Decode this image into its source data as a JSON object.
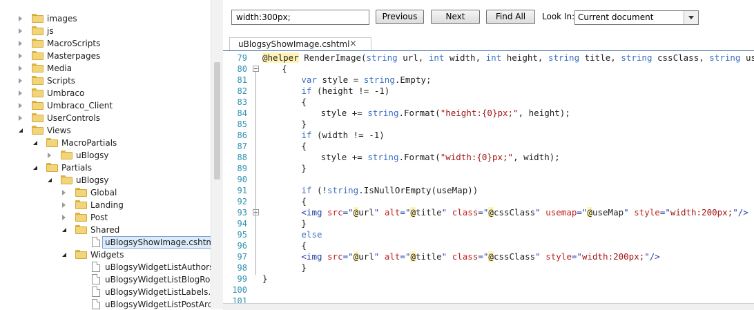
{
  "tree": {
    "items": [
      {
        "label": "images",
        "level": 0,
        "expander": "collapsed",
        "icon": "folder"
      },
      {
        "label": "js",
        "level": 0,
        "expander": "collapsed",
        "icon": "folder"
      },
      {
        "label": "MacroScripts",
        "level": 0,
        "expander": "collapsed",
        "icon": "folder"
      },
      {
        "label": "Masterpages",
        "level": 0,
        "expander": "collapsed",
        "icon": "folder"
      },
      {
        "label": "Media",
        "level": 0,
        "expander": "collapsed",
        "icon": "folder"
      },
      {
        "label": "Scripts",
        "level": 0,
        "expander": "collapsed",
        "icon": "folder"
      },
      {
        "label": "Umbraco",
        "level": 0,
        "expander": "collapsed",
        "icon": "folder"
      },
      {
        "label": "Umbraco_Client",
        "level": 0,
        "expander": "collapsed",
        "icon": "folder"
      },
      {
        "label": "UserControls",
        "level": 0,
        "expander": "collapsed",
        "icon": "folder"
      },
      {
        "label": "Views",
        "level": 0,
        "expander": "expanded",
        "icon": "folder"
      },
      {
        "label": "MacroPartials",
        "level": 1,
        "expander": "expanded",
        "icon": "folder"
      },
      {
        "label": "uBlogsy",
        "level": 2,
        "expander": "collapsed",
        "icon": "folder"
      },
      {
        "label": "Partials",
        "level": 1,
        "expander": "expanded",
        "icon": "folder"
      },
      {
        "label": "uBlogsy",
        "level": 2,
        "expander": "expanded",
        "icon": "folder"
      },
      {
        "label": "Global",
        "level": 3,
        "expander": "collapsed",
        "icon": "folder"
      },
      {
        "label": "Landing",
        "level": 3,
        "expander": "collapsed",
        "icon": "folder"
      },
      {
        "label": "Post",
        "level": 3,
        "expander": "collapsed",
        "icon": "folder"
      },
      {
        "label": "Shared",
        "level": 3,
        "expander": "expanded",
        "icon": "folder"
      },
      {
        "label": "uBlogsyShowImage.cshtml",
        "level": 4,
        "expander": "none",
        "icon": "file",
        "selected": true
      },
      {
        "label": "Widgets",
        "level": 3,
        "expander": "expanded",
        "icon": "folder"
      },
      {
        "label": "uBlogsyWidgetListAuthors.c",
        "level": 4,
        "expander": "none",
        "icon": "file"
      },
      {
        "label": "uBlogsyWidgetListBlogRoll.c",
        "level": 4,
        "expander": "none",
        "icon": "file"
      },
      {
        "label": "uBlogsyWidgetListLabels.csh",
        "level": 4,
        "expander": "none",
        "icon": "file"
      },
      {
        "label": "uBlogsyWidgetListPostArchi",
        "level": 4,
        "expander": "none",
        "icon": "file"
      }
    ]
  },
  "findbar": {
    "query": "width:300px;",
    "previous_label": "Previous",
    "next_label": "Next",
    "find_all_label": "Find All",
    "look_in_label": "Look In:",
    "look_in_value": "Current document"
  },
  "editor": {
    "tab_label": "uBlogsyShowImage.cshtml",
    "tab_close": "×",
    "lines": [
      {
        "n": "79",
        "indent": 0,
        "tokens": [
          [
            "razor",
            "@helper"
          ],
          [
            "plain",
            " RenderImage("
          ],
          [
            "kw",
            "string"
          ],
          [
            "plain",
            " url, "
          ],
          [
            "kw",
            "int"
          ],
          [
            "plain",
            " width, "
          ],
          [
            "kw",
            "int"
          ],
          [
            "plain",
            " height, "
          ],
          [
            "kw",
            "string"
          ],
          [
            "plain",
            " title, "
          ],
          [
            "kw",
            "string"
          ],
          [
            "plain",
            " cssClass, "
          ],
          [
            "kw",
            "string"
          ],
          [
            "plain",
            " useMap)"
          ]
        ]
      },
      {
        "n": "80",
        "indent": 4,
        "fold": true,
        "tokens": [
          [
            "plain",
            "{"
          ]
        ]
      },
      {
        "n": "81",
        "indent": 8,
        "tokens": [
          [
            "kw",
            "var"
          ],
          [
            "plain",
            " style = "
          ],
          [
            "kw",
            "string"
          ],
          [
            "plain",
            ".Empty;"
          ]
        ]
      },
      {
        "n": "82",
        "indent": 8,
        "tokens": [
          [
            "kw",
            "if"
          ],
          [
            "plain",
            " (height != -1)"
          ]
        ]
      },
      {
        "n": "83",
        "indent": 8,
        "tokens": [
          [
            "plain",
            "{"
          ]
        ]
      },
      {
        "n": "84",
        "indent": 12,
        "tokens": [
          [
            "plain",
            "style += "
          ],
          [
            "kw",
            "string"
          ],
          [
            "plain",
            ".Format("
          ],
          [
            "str",
            "\"height:{0}px;\""
          ],
          [
            "plain",
            ", height);"
          ]
        ]
      },
      {
        "n": "85",
        "indent": 8,
        "tokens": [
          [
            "plain",
            "}"
          ]
        ]
      },
      {
        "n": "86",
        "indent": 8,
        "tokens": [
          [
            "kw",
            "if"
          ],
          [
            "plain",
            " (width != -1)"
          ]
        ]
      },
      {
        "n": "87",
        "indent": 8,
        "tokens": [
          [
            "plain",
            "{"
          ]
        ]
      },
      {
        "n": "88",
        "indent": 12,
        "tokens": [
          [
            "plain",
            "style += "
          ],
          [
            "kw",
            "string"
          ],
          [
            "plain",
            ".Format("
          ],
          [
            "str",
            "\"width:{0}px;\""
          ],
          [
            "plain",
            ", width);"
          ]
        ]
      },
      {
        "n": "89",
        "indent": 8,
        "tokens": [
          [
            "plain",
            "}"
          ]
        ]
      },
      {
        "n": "90",
        "indent": 0,
        "tokens": []
      },
      {
        "n": "91",
        "indent": 8,
        "tokens": [
          [
            "kw",
            "if"
          ],
          [
            "plain",
            " (!"
          ],
          [
            "kw",
            "string"
          ],
          [
            "plain",
            ".IsNullOrEmpty(useMap))"
          ]
        ]
      },
      {
        "n": "92",
        "indent": 8,
        "tokens": [
          [
            "plain",
            "{"
          ]
        ]
      },
      {
        "n": "93",
        "indent": 8,
        "fold": true,
        "tokens": [
          [
            "tag",
            "<img"
          ],
          [
            "plain",
            " "
          ],
          [
            "attr",
            "src"
          ],
          [
            "tag",
            "=\""
          ],
          [
            "razor",
            "@"
          ],
          [
            "plain",
            "url"
          ],
          [
            "tag",
            "\""
          ],
          [
            "plain",
            " "
          ],
          [
            "attr",
            "alt"
          ],
          [
            "tag",
            "=\""
          ],
          [
            "razor",
            "@"
          ],
          [
            "plain",
            "title"
          ],
          [
            "tag",
            "\""
          ],
          [
            "plain",
            " "
          ],
          [
            "attr",
            "class"
          ],
          [
            "tag",
            "=\""
          ],
          [
            "razor",
            "@"
          ],
          [
            "plain",
            "cssClass"
          ],
          [
            "tag",
            "\""
          ],
          [
            "plain",
            " "
          ],
          [
            "attr",
            "usemap"
          ],
          [
            "tag",
            "=\""
          ],
          [
            "razor",
            "@"
          ],
          [
            "plain",
            "useMap"
          ],
          [
            "tag",
            "\""
          ],
          [
            "plain",
            " "
          ],
          [
            "attr",
            "style"
          ],
          [
            "tag",
            "=\""
          ],
          [
            "str",
            "width:200px;"
          ],
          [
            "tag",
            "\"/>"
          ]
        ]
      },
      {
        "n": "94",
        "indent": 8,
        "tokens": [
          [
            "plain",
            "}"
          ]
        ]
      },
      {
        "n": "95",
        "indent": 8,
        "tokens": [
          [
            "kw",
            "else"
          ]
        ]
      },
      {
        "n": "96",
        "indent": 8,
        "tokens": [
          [
            "plain",
            "{"
          ]
        ]
      },
      {
        "n": "97",
        "indent": 8,
        "tokens": [
          [
            "tag",
            "<img"
          ],
          [
            "plain",
            " "
          ],
          [
            "attr",
            "src"
          ],
          [
            "tag",
            "=\""
          ],
          [
            "razor",
            "@"
          ],
          [
            "plain",
            "url"
          ],
          [
            "tag",
            "\""
          ],
          [
            "plain",
            " "
          ],
          [
            "attr",
            "alt"
          ],
          [
            "tag",
            "=\""
          ],
          [
            "razor",
            "@"
          ],
          [
            "plain",
            "title"
          ],
          [
            "tag",
            "\""
          ],
          [
            "plain",
            " "
          ],
          [
            "attr",
            "class"
          ],
          [
            "tag",
            "=\""
          ],
          [
            "razor",
            "@"
          ],
          [
            "plain",
            "cssClass"
          ],
          [
            "tag",
            "\""
          ],
          [
            "plain",
            " "
          ],
          [
            "attr",
            "style"
          ],
          [
            "tag",
            "=\""
          ],
          [
            "str",
            "width:200px;"
          ],
          [
            "tag",
            "\"/>"
          ]
        ]
      },
      {
        "n": "98",
        "indent": 8,
        "tokens": [
          [
            "plain",
            "}"
          ]
        ]
      },
      {
        "n": "99",
        "indent": 0,
        "tokens": [
          [
            "plain",
            "}"
          ]
        ]
      },
      {
        "n": "100",
        "indent": 0,
        "tokens": []
      },
      {
        "n": "101",
        "indent": 0,
        "tokens": []
      }
    ]
  },
  "colors": {
    "keyword": "#3a6fc4",
    "string": "#a31515",
    "line_number": "#2b91af",
    "razor_highlight": "#fff4b5",
    "selection": "#dcebfb"
  }
}
